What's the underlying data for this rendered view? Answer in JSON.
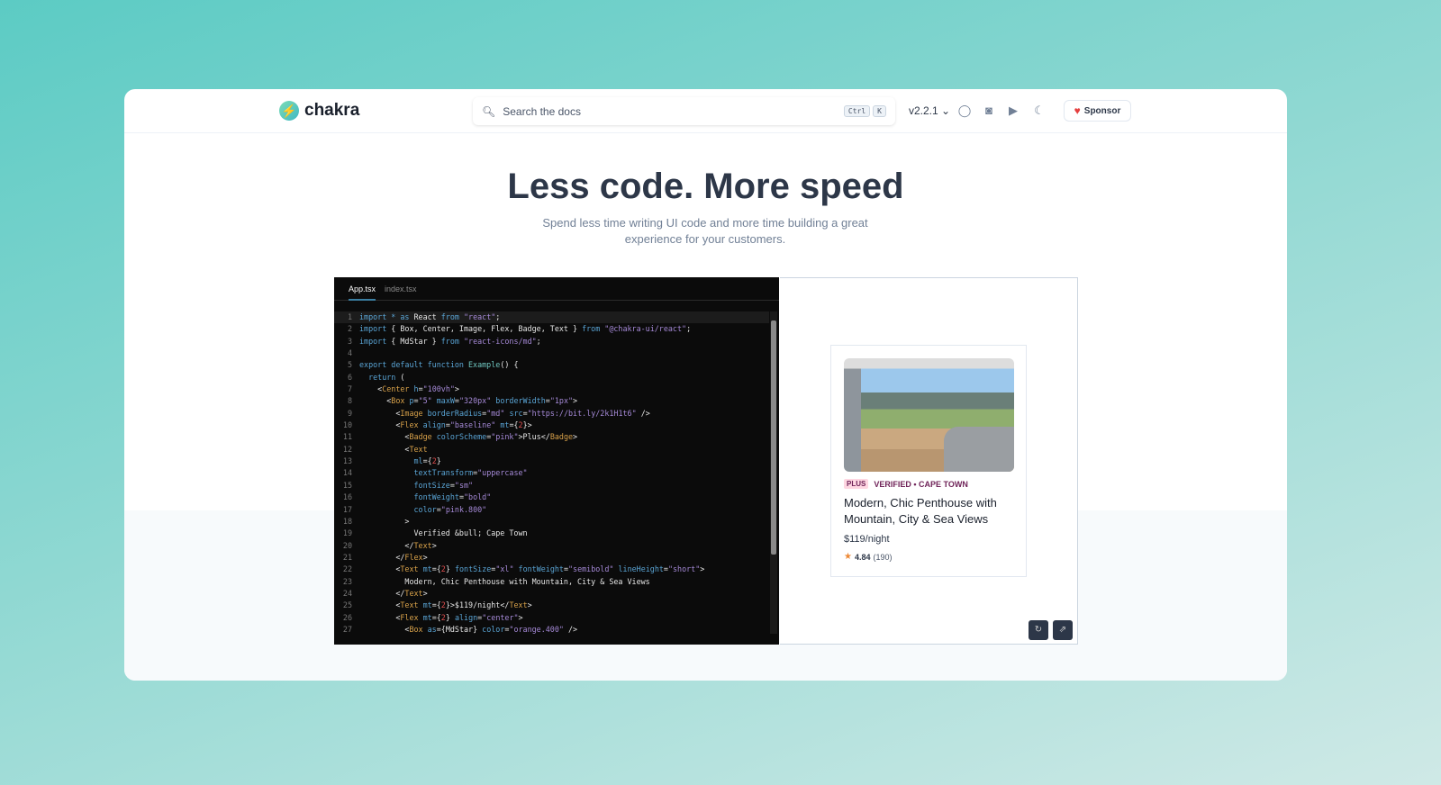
{
  "header": {
    "logo": "chakra",
    "search_placeholder": "Search the docs",
    "kbd": [
      "Ctrl",
      "K"
    ],
    "version": "v2.2.1",
    "sponsor": "Sponsor"
  },
  "hero": {
    "title": "Less code. More speed",
    "subtitle": "Spend less time writing UI code and more time building a great experience for your customers."
  },
  "editor": {
    "tabs": [
      "App.tsx",
      "index.tsx"
    ],
    "active_tab": "App.tsx",
    "lines": [
      [
        [
          "k",
          "import "
        ],
        [
          "k",
          "* as "
        ],
        [
          "",
          "React "
        ],
        [
          "k",
          "from "
        ],
        [
          "s",
          "\"react\""
        ],
        [
          "",
          ";"
        ]
      ],
      [
        [
          "k",
          "import "
        ],
        [
          "",
          "{ Box, Center, Image, Flex, Badge, Text } "
        ],
        [
          "k",
          "from "
        ],
        [
          "s",
          "\"@chakra-ui/react\""
        ],
        [
          "",
          ";"
        ]
      ],
      [
        [
          "k",
          "import "
        ],
        [
          "",
          "{ MdStar } "
        ],
        [
          "k",
          "from "
        ],
        [
          "s",
          "\"react-icons/md\""
        ],
        [
          "",
          ";"
        ]
      ],
      [],
      [
        [
          "k",
          "export default function "
        ],
        [
          "f",
          "Example"
        ],
        [
          "",
          "() {"
        ]
      ],
      [
        [
          "",
          "  "
        ],
        [
          "k",
          "return "
        ],
        [
          "",
          "("
        ]
      ],
      [
        [
          "",
          "    <"
        ],
        [
          "t",
          "Center "
        ],
        [
          "a",
          "h"
        ],
        [
          "",
          "="
        ],
        [
          "s",
          "\"100vh\""
        ],
        [
          "",
          ">"
        ]
      ],
      [
        [
          "",
          "      <"
        ],
        [
          "t",
          "Box "
        ],
        [
          "a",
          "p"
        ],
        [
          "",
          "="
        ],
        [
          "s",
          "\"5\" "
        ],
        [
          "a",
          "maxW"
        ],
        [
          "",
          "="
        ],
        [
          "s",
          "\"320px\" "
        ],
        [
          "a",
          "borderWidth"
        ],
        [
          "",
          "="
        ],
        [
          "s",
          "\"1px\""
        ],
        [
          "",
          ">"
        ]
      ],
      [
        [
          "",
          "        <"
        ],
        [
          "t",
          "Image "
        ],
        [
          "a",
          "borderRadius"
        ],
        [
          "",
          "="
        ],
        [
          "s",
          "\"md\" "
        ],
        [
          "a",
          "src"
        ],
        [
          "",
          "="
        ],
        [
          "s",
          "\"https://bit.ly/2k1H1t6\" "
        ],
        [
          "",
          "/>"
        ]
      ],
      [
        [
          "",
          "        <"
        ],
        [
          "t",
          "Flex "
        ],
        [
          "a",
          "align"
        ],
        [
          "",
          "="
        ],
        [
          "s",
          "\"baseline\" "
        ],
        [
          "a",
          "mt"
        ],
        [
          "",
          "={"
        ],
        [
          "n",
          "2"
        ],
        [
          "",
          "}>"
        ]
      ],
      [
        [
          "",
          "          <"
        ],
        [
          "t",
          "Badge "
        ],
        [
          "a",
          "colorScheme"
        ],
        [
          "",
          "="
        ],
        [
          "s",
          "\"pink\""
        ],
        [
          "",
          ">Plus</"
        ],
        [
          "t",
          "Badge"
        ],
        [
          "",
          ">"
        ]
      ],
      [
        [
          "",
          "          <"
        ],
        [
          "t",
          "Text"
        ]
      ],
      [
        [
          "",
          "            "
        ],
        [
          "a",
          "ml"
        ],
        [
          "",
          "={"
        ],
        [
          "n",
          "2"
        ],
        [
          "",
          "}"
        ]
      ],
      [
        [
          "",
          "            "
        ],
        [
          "a",
          "textTransform"
        ],
        [
          "",
          "="
        ],
        [
          "s",
          "\"uppercase\""
        ]
      ],
      [
        [
          "",
          "            "
        ],
        [
          "a",
          "fontSize"
        ],
        [
          "",
          "="
        ],
        [
          "s",
          "\"sm\""
        ]
      ],
      [
        [
          "",
          "            "
        ],
        [
          "a",
          "fontWeight"
        ],
        [
          "",
          "="
        ],
        [
          "s",
          "\"bold\""
        ]
      ],
      [
        [
          "",
          "            "
        ],
        [
          "a",
          "color"
        ],
        [
          "",
          "="
        ],
        [
          "s",
          "\"pink.800\""
        ]
      ],
      [
        [
          "",
          "          >"
        ]
      ],
      [
        [
          "",
          "            Verified &bull; Cape Town"
        ]
      ],
      [
        [
          "",
          "          </"
        ],
        [
          "t",
          "Text"
        ],
        [
          "",
          ">"
        ]
      ],
      [
        [
          "",
          "        </"
        ],
        [
          "t",
          "Flex"
        ],
        [
          "",
          ">"
        ]
      ],
      [
        [
          "",
          "        <"
        ],
        [
          "t",
          "Text "
        ],
        [
          "a",
          "mt"
        ],
        [
          "",
          "={"
        ],
        [
          "n",
          "2"
        ],
        [
          "",
          "} "
        ],
        [
          "a",
          "fontSize"
        ],
        [
          "",
          "="
        ],
        [
          "s",
          "\"xl\" "
        ],
        [
          "a",
          "fontWeight"
        ],
        [
          "",
          "="
        ],
        [
          "s",
          "\"semibold\" "
        ],
        [
          "a",
          "lineHeight"
        ],
        [
          "",
          "="
        ],
        [
          "s",
          "\"short\""
        ],
        [
          "",
          ">"
        ]
      ],
      [
        [
          "",
          "          Modern, Chic Penthouse with Mountain, City & Sea Views"
        ]
      ],
      [
        [
          "",
          "        </"
        ],
        [
          "t",
          "Text"
        ],
        [
          "",
          ">"
        ]
      ],
      [
        [
          "",
          "        <"
        ],
        [
          "t",
          "Text "
        ],
        [
          "a",
          "mt"
        ],
        [
          "",
          "={"
        ],
        [
          "n",
          "2"
        ],
        [
          "",
          "}>$119/night</"
        ],
        [
          "t",
          "Text"
        ],
        [
          "",
          ">"
        ]
      ],
      [
        [
          "",
          "        <"
        ],
        [
          "t",
          "Flex "
        ],
        [
          "a",
          "mt"
        ],
        [
          "",
          "={"
        ],
        [
          "n",
          "2"
        ],
        [
          "",
          "} "
        ],
        [
          "a",
          "align"
        ],
        [
          "",
          "="
        ],
        [
          "s",
          "\"center\""
        ],
        [
          "",
          ">"
        ]
      ],
      [
        [
          "",
          "          <"
        ],
        [
          "t",
          "Box "
        ],
        [
          "a",
          "as"
        ],
        [
          "",
          "={MdStar} "
        ],
        [
          "a",
          "color"
        ],
        [
          "",
          "="
        ],
        [
          "s",
          "\"orange.400\" "
        ],
        [
          "",
          "/>"
        ]
      ]
    ]
  },
  "preview": {
    "badge": "Plus",
    "location": "Verified • Cape Town",
    "title": "Modern, Chic Penthouse with Mountain, City & Sea Views",
    "price": "$119/night",
    "rating": "4.84",
    "reviews": "(190)"
  },
  "colors": {
    "accent": "#3fb8c4",
    "badge_text": "#702459",
    "badge_bg": "#fed7e2",
    "star": "#ed8936"
  }
}
